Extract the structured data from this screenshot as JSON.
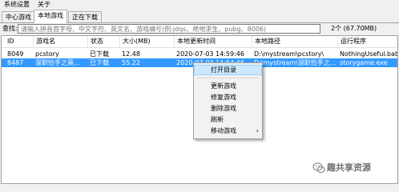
{
  "menubar": {
    "items": [
      "系统设置",
      "关于"
    ]
  },
  "tabs": [
    {
      "label": "中心游戏",
      "active": false
    },
    {
      "label": "本地游戏",
      "active": true
    },
    {
      "label": "正在下载",
      "active": false
    }
  ],
  "search": {
    "label": "查找:",
    "placeholder": "请输入拼音首字母、中文字符、英文名、游戏编号(例:jdqs、绝地求生、pubg、8006)",
    "count": "2个 (67.70MB)"
  },
  "table": {
    "columns": [
      "ID",
      "游戏名",
      "状态",
      "大小(MB)",
      "本地更新时间",
      "本地路径",
      "运行程序"
    ],
    "rows": [
      {
        "id": "8049",
        "name": "pcstory",
        "status": "已下载",
        "size": "12.48",
        "time": "2020-07-03 14:59:46",
        "path": "D:\\mystream\\pcstory\\",
        "exe": "NothingUseful.bat",
        "selected": false
      },
      {
        "id": "8487",
        "name": "混职恰手之莫...",
        "status": "已下载",
        "size": "55.22",
        "time": "2020-07-03 14:54:46",
        "path": "D:\\mystream\\混职恰手之...",
        "exe": "storygame.exe",
        "selected": true
      }
    ]
  },
  "context_menu": {
    "items": [
      "打开目录",
      "更新游戏",
      "修复游戏",
      "删除游戏",
      "刷新",
      "移动游戏"
    ],
    "highlighted": "打开目录",
    "submenu_arrow": "›"
  },
  "watermark": {
    "text": "趣共享资源"
  },
  "colors": {
    "selection": "#3399ff",
    "menu_highlight": "#cce8ff"
  }
}
